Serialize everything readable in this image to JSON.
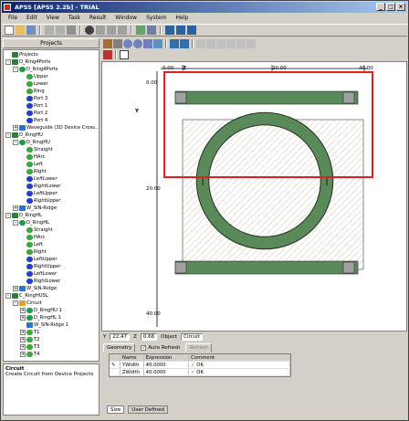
{
  "window": {
    "title": "APSS [APSS 2.2b] - TRIAL",
    "title_colors": [
      "#0a246a",
      "#a6caf0"
    ]
  },
  "menu": [
    "File",
    "Edit",
    "View",
    "Task",
    "Result",
    "Window",
    "System",
    "Help"
  ],
  "left_panel": {
    "header": "Projects",
    "tree": [
      {
        "label": "Projects",
        "level": 0,
        "icon": "folder-icon",
        "italic": true
      },
      {
        "label": "D_Ring4Ports",
        "level": 0,
        "icon": "project-icon",
        "toggle": "-"
      },
      {
        "label": "D_Ring4Ports",
        "level": 1,
        "icon": "ring-icon",
        "toggle": "-"
      },
      {
        "label": "Upper",
        "level": 2,
        "icon": "segment-icon"
      },
      {
        "label": "Lower",
        "level": 2,
        "icon": "segment-icon"
      },
      {
        "label": "Ring",
        "level": 2,
        "icon": "segment-icon"
      },
      {
        "label": "Port 3",
        "level": 2,
        "icon": "port-icon"
      },
      {
        "label": "Port 1",
        "level": 2,
        "icon": "port-icon"
      },
      {
        "label": "Port 2",
        "level": 2,
        "icon": "port-icon"
      },
      {
        "label": "Port 4",
        "level": 2,
        "icon": "port-icon"
      },
      {
        "label": "Waveguide (3D Device Cross...",
        "level": 1,
        "icon": "waveguide-icon",
        "toggle": "+"
      },
      {
        "label": "D_RingHU",
        "level": 0,
        "icon": "project-icon",
        "toggle": "-"
      },
      {
        "label": "D_RingHU",
        "level": 1,
        "icon": "ring-icon",
        "toggle": "-"
      },
      {
        "label": "Straight",
        "level": 2,
        "icon": "segment-icon"
      },
      {
        "label": "HArc",
        "level": 2,
        "icon": "segment-icon"
      },
      {
        "label": "Left",
        "level": 2,
        "icon": "segment-icon"
      },
      {
        "label": "Right",
        "level": 2,
        "icon": "segment-icon"
      },
      {
        "label": "LeftLower",
        "level": 2,
        "icon": "port-icon",
        "italic": true
      },
      {
        "label": "RightLower",
        "level": 2,
        "icon": "port-icon",
        "italic": true
      },
      {
        "label": "LeftUpper",
        "level": 2,
        "icon": "port-icon",
        "italic": true
      },
      {
        "label": "RightUpper",
        "level": 2,
        "icon": "port-icon",
        "italic": true
      },
      {
        "label": "W_SiN-Ridge",
        "level": 1,
        "icon": "waveguide-icon",
        "toggle": "+"
      },
      {
        "label": "D_RingHL",
        "level": 0,
        "icon": "project-icon",
        "toggle": "-"
      },
      {
        "label": "D_RingHL",
        "level": 1,
        "icon": "ring-icon",
        "toggle": "-"
      },
      {
        "label": "Straight",
        "level": 2,
        "icon": "segment-icon"
      },
      {
        "label": "HArc",
        "level": 2,
        "icon": "segment-icon"
      },
      {
        "label": "Left",
        "level": 2,
        "icon": "segment-icon"
      },
      {
        "label": "Right",
        "level": 2,
        "icon": "segment-icon"
      },
      {
        "label": "LeftUpper",
        "level": 2,
        "icon": "port-icon"
      },
      {
        "label": "RightUpper",
        "level": 2,
        "icon": "port-icon"
      },
      {
        "label": "LeftLower",
        "level": 2,
        "icon": "port-icon"
      },
      {
        "label": "RightLower",
        "level": 2,
        "icon": "port-icon"
      },
      {
        "label": "W_SiN-Ridge",
        "level": 1,
        "icon": "waveguide-icon",
        "toggle": "+"
      },
      {
        "label": "C_RingHUSL",
        "level": 0,
        "icon": "project-icon",
        "toggle": "-"
      },
      {
        "label": "Circuit",
        "level": 1,
        "icon": "circuit-icon",
        "toggle": "-"
      },
      {
        "label": "D_RingHU 1",
        "level": 2,
        "icon": "ring-icon",
        "toggle": "+"
      },
      {
        "label": "D_RingHL 1",
        "level": 2,
        "icon": "ring-icon",
        "toggle": "+"
      },
      {
        "label": "W_SiN-Ridge 1",
        "level": 2,
        "icon": "waveguide-icon"
      },
      {
        "label": "T1",
        "level": 2,
        "icon": "segment-icon",
        "toggle": "+"
      },
      {
        "label": "T2",
        "level": 2,
        "icon": "segment-icon",
        "toggle": "+"
      },
      {
        "label": "T3",
        "level": 2,
        "icon": "segment-icon",
        "toggle": "+"
      },
      {
        "label": "T4",
        "level": 2,
        "icon": "segment-icon",
        "toggle": "+"
      }
    ],
    "description_title": "Circuit",
    "description_text": "Create Circuit from Device Projects"
  },
  "viewer": {
    "ruler_x": [
      "0.00",
      "20.00",
      "40.00"
    ],
    "ruler_y": [
      "0.00",
      "20.00",
      "40.00"
    ],
    "axis_z": "Z",
    "axis_y": "Y",
    "waveguide_color": "#5a8a5a",
    "selection_color": "#e02020"
  },
  "status": {
    "y_label": "Y",
    "y_value": "22.47",
    "z_label": "Z",
    "z_value": "0.66",
    "object_label": "Object",
    "object_value": "Circuit"
  },
  "properties": {
    "tab_geometry": "Geometry",
    "auto_refresh_label": "Auto Refresh",
    "auto_refresh_checked": true,
    "refresh_button": "Refresh",
    "columns": [
      "Name",
      "Expression",
      "Comment"
    ],
    "rows": [
      {
        "name": "YWidth",
        "expression": "40.0000",
        "comment": "OK"
      },
      {
        "name": "ZWidth",
        "expression": "40.0000",
        "comment": "OK"
      }
    ],
    "bottom_tabs": [
      "Size",
      "User Defined"
    ]
  }
}
